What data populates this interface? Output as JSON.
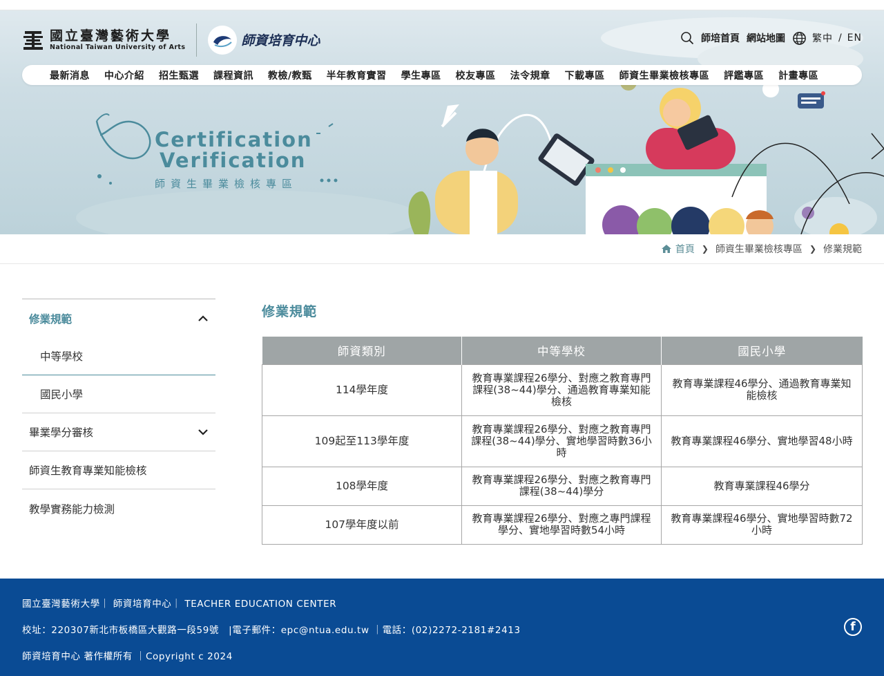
{
  "header": {
    "univ_name_zh": "國立臺灣藝術大學",
    "univ_name_en": "National Taiwan University of Arts",
    "center_name": "師資培育中心",
    "utility": {
      "home_label": "師培首頁",
      "sitemap_label": "網站地圖",
      "lang_zh": "繁中",
      "lang_sep": "/",
      "lang_en": "EN"
    },
    "nav": [
      "最新消息",
      "中心介紹",
      "招生甄選",
      "課程資訊",
      "教檢/教甄",
      "半年教育實習",
      "學生專區",
      "校友專區",
      "法令規章",
      "下載專區",
      "師資生畢業檢核專區",
      "評鑑專區",
      "計畫專區"
    ]
  },
  "banner": {
    "title_en_line1": "Certification",
    "title_en_line2": "Verification",
    "title_zh": "師資生畢業檢核專區"
  },
  "breadcrumb": [
    "首頁",
    "師資生畢業檢核專區",
    "修業規範"
  ],
  "sidebar": {
    "items": [
      {
        "label": "修業規範",
        "active": true,
        "expanded": true,
        "children": [
          "中等學校",
          "國民小學"
        ]
      },
      {
        "label": "畢業學分審核",
        "expanded": false
      },
      {
        "label": "師資生教育專業知能檢核"
      },
      {
        "label": "教學實務能力檢測"
      }
    ]
  },
  "main": {
    "title": "修業規範",
    "table": {
      "headers": [
        "師資類別",
        "中等學校",
        "國民小學"
      ],
      "rows": [
        [
          "114學年度",
          "教育專業課程26學分、對應之教育專門課程(38~44)學分、通過教育專業知能檢核",
          "教育專業課程46學分、通過教育專業知能檢核"
        ],
        [
          "109起至113學年度",
          "教育專業課程26學分、對應之教育專門課程(38~44)學分、實地學習時數36小時",
          "教育專業課程46學分、實地學習48小時"
        ],
        [
          "108學年度",
          "教育專業課程26學分、對應之教育專門課程(38~44)學分",
          "教育專業課程46學分"
        ],
        [
          "107學年度以前",
          "教育專業課程26學分、對應之專門課程學分、實地學習時數54小時",
          "教育專業課程46學分、實地學習時數72小時"
        ]
      ]
    }
  },
  "footer": {
    "line1": "國立臺灣藝術大學｜ 師資培育中心｜ TEACHER EDUCATION CENTER",
    "line2": "校址：220307新北市板橋區大觀路一段59號　|電子郵件：epc@ntua.edu.tw ｜電話：(02)2272-2181#2413",
    "line3": "師資培育中心 著作權所有 ｜Copyright c 2024",
    "social_icon": "facebook-icon"
  },
  "colors": {
    "accent": "#4b8b9c",
    "footer_bg": "#0a4b94",
    "table_header": "#9fa5a6"
  }
}
